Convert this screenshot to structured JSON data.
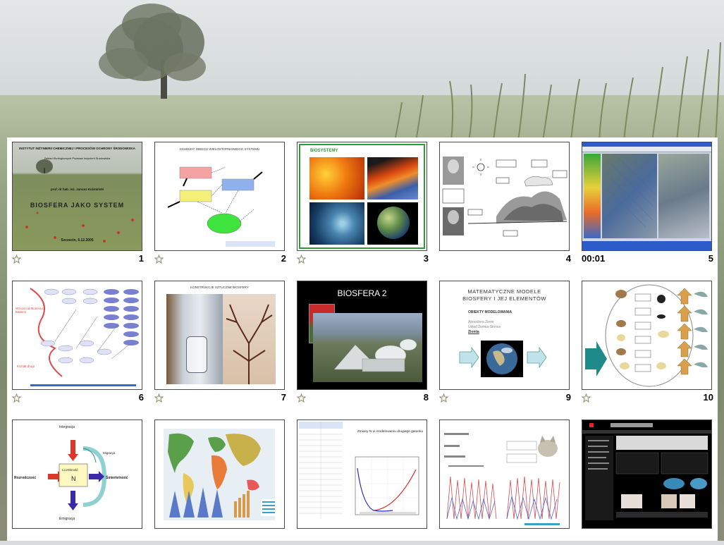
{
  "colors": {
    "panel": "#ffffff",
    "thumb_border": "#4a4a4a",
    "title_blue": "#2a2aa0",
    "green_frame": "#2e9a3a"
  },
  "slides": [
    {
      "number": "1",
      "header": "INSTYTUT INŻYNIERII CHEMICZNEJ I PROCESÓW OCHRONY ŚRODOWISKA",
      "header2": "Zakład Ekologicznych Podstaw Inżynierii Środowiska",
      "author": "prof. dr hab. inż. Janusz Koźmiński",
      "title": "BIOSFERA JAKO SYSTEM",
      "date": "Szczecin, 6.12.2005"
    },
    {
      "number": "2",
      "title": "SCHEMAT OBIEGU WIELOSTOPNIOWEGO SYSTEMU"
    },
    {
      "number": "3",
      "title": "BIOSYSTEMY"
    },
    {
      "number": "4"
    },
    {
      "number": "5",
      "timing": "00:01"
    },
    {
      "number": "6",
      "label_a": "Wzrost od Monera i Bakterii",
      "label_b": "Kształt drogi"
    },
    {
      "number": "7",
      "title": "KONSTRUKCJE SZTUCZNE BIOSFERY"
    },
    {
      "number": "8",
      "title": "BIOSFERA 2"
    },
    {
      "number": "9",
      "title": "MATEMATYCZNE MODELE",
      "title2": "BIOSFERY I JEJ ELEMENTÓW",
      "subtitle": "OBIEKTY MODELOWANIA",
      "line1": "Atmosfera Ziemi",
      "line2": "Układ Ziemia-Słońce",
      "line3": "Ziemia"
    },
    {
      "number": "10"
    },
    {
      "number": "",
      "top": "Integracja",
      "bottom": "Emigracja",
      "left": "Rozrodczość",
      "right": "Śmiertelność",
      "center": "Liczebność",
      "n": "N",
      "side": "Migracja"
    },
    {
      "number": ""
    },
    {
      "number": "",
      "title": "Zmiany N w modelowaniu drugiego gatunku"
    },
    {
      "number": ""
    },
    {
      "number": ""
    }
  ]
}
